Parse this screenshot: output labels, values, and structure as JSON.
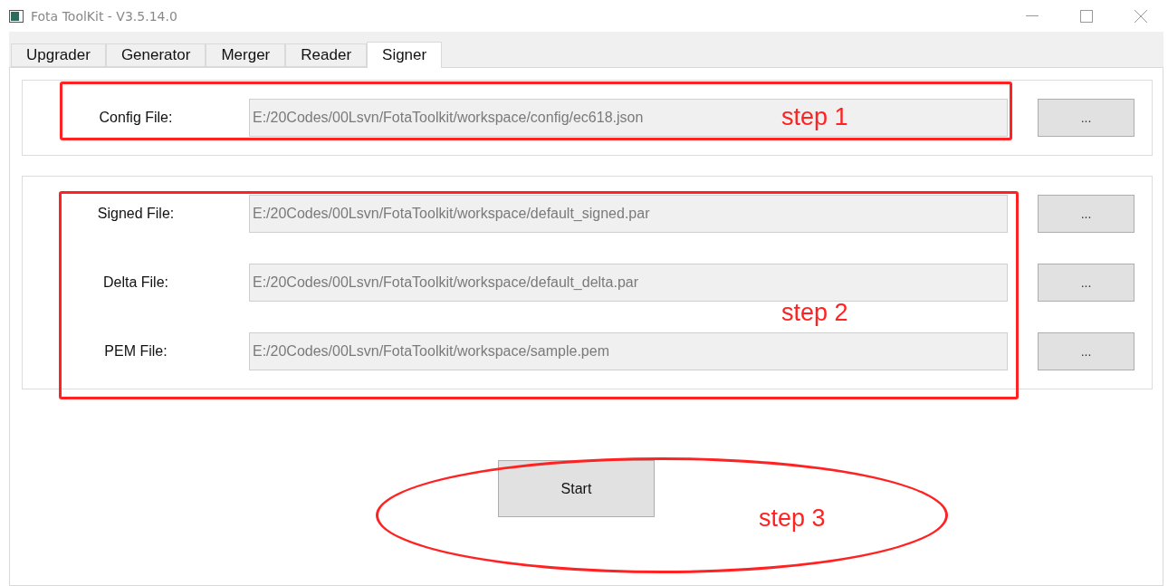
{
  "window": {
    "title": "Fota ToolKit - V3.5.14.0"
  },
  "tabs": [
    {
      "label": "Upgrader",
      "selected": false
    },
    {
      "label": "Generator",
      "selected": false
    },
    {
      "label": "Merger",
      "selected": false
    },
    {
      "label": "Reader",
      "selected": false
    },
    {
      "label": "Signer",
      "selected": true
    }
  ],
  "groups": [
    {
      "rows": [
        {
          "label": "Config File:",
          "value": "E:/20Codes/00Lsvn/FotaToolkit/workspace/config/ec618.json",
          "browse": "..."
        }
      ]
    },
    {
      "rows": [
        {
          "label": "Signed File:",
          "value": "E:/20Codes/00Lsvn/FotaToolkit/workspace/default_signed.par",
          "browse": "..."
        },
        {
          "label": "Delta File:",
          "value": "E:/20Codes/00Lsvn/FotaToolkit/workspace/default_delta.par",
          "browse": "..."
        },
        {
          "label": "PEM File:",
          "value": "E:/20Codes/00Lsvn/FotaToolkit/workspace/sample.pem",
          "browse": "..."
        }
      ]
    }
  ],
  "start_button": "Start",
  "annotations": [
    {
      "kind": "rect",
      "label": "step 1"
    },
    {
      "kind": "rect",
      "label": "step 2"
    },
    {
      "kind": "ellipse",
      "label": "step 3"
    }
  ]
}
